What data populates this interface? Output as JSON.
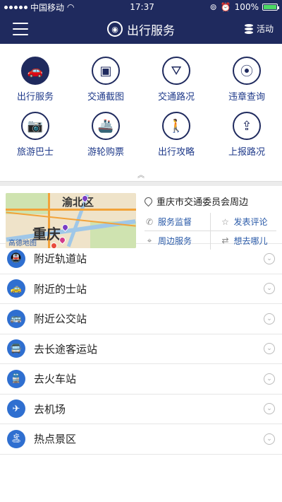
{
  "status": {
    "carrier": "中国移动",
    "time": "17:37",
    "battery": "100%",
    "battery_level": 1.0
  },
  "header": {
    "title": "出行服务",
    "action_label": "活动"
  },
  "grid": [
    {
      "label": "出行服务",
      "icon": "car-icon",
      "glyph": "🚗",
      "filled": true
    },
    {
      "label": "交通截图",
      "icon": "image-icon",
      "glyph": "▣",
      "filled": false
    },
    {
      "label": "交通路况",
      "icon": "road-icon",
      "glyph": "⛛",
      "filled": false
    },
    {
      "label": "违章查询",
      "icon": "traffic-light-icon",
      "glyph": "⦿",
      "filled": false
    },
    {
      "label": "旅游巴士",
      "icon": "camera-icon",
      "glyph": "📷",
      "filled": false
    },
    {
      "label": "游轮购票",
      "icon": "ship-icon",
      "glyph": "🚢",
      "filled": false
    },
    {
      "label": "出行攻略",
      "icon": "hiker-icon",
      "glyph": "🚶",
      "filled": false
    },
    {
      "label": "上报路况",
      "icon": "upload-icon",
      "glyph": "⇪",
      "filled": false
    }
  ],
  "map": {
    "district_label": "渝北区",
    "city_label": "重庆",
    "watermark": "高德地图"
  },
  "location": {
    "text": "重庆市交通委员会周边"
  },
  "links": [
    {
      "label": "服务监督",
      "icon": "phone-icon",
      "glyph": "✆"
    },
    {
      "label": "发表评论",
      "icon": "star-icon",
      "glyph": "☆"
    },
    {
      "label": "周边服务",
      "icon": "location-icon",
      "glyph": "⌖"
    },
    {
      "label": "想去哪儿",
      "icon": "swap-icon",
      "glyph": "⇄"
    }
  ],
  "list": [
    {
      "label": "附近轨道站",
      "icon": "metro-icon",
      "glyph": "🚇"
    },
    {
      "label": "附近的士站",
      "icon": "taxi-icon",
      "glyph": "🚕"
    },
    {
      "label": "附近公交站",
      "icon": "bus-stop-icon",
      "glyph": "🚌"
    },
    {
      "label": "去长途客运站",
      "icon": "coach-icon",
      "glyph": "🚍"
    },
    {
      "label": "去火车站",
      "icon": "train-icon",
      "glyph": "🚆"
    },
    {
      "label": "去机场",
      "icon": "airplane-icon",
      "glyph": "✈"
    },
    {
      "label": "热点景区",
      "icon": "scenic-icon",
      "glyph": "🏝"
    }
  ],
  "colors": {
    "navy": "#1f2a5e",
    "accent": "#2f6fd0"
  }
}
